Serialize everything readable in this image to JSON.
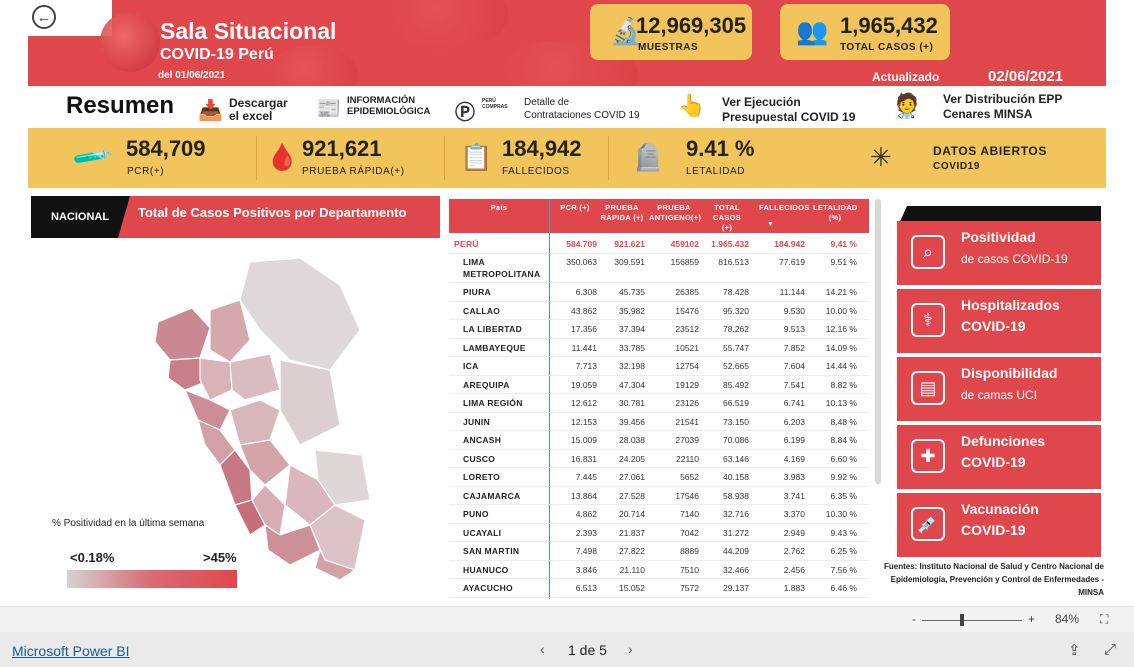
{
  "header": {
    "title": "Sala Situacional",
    "subtitle": "COVID-19 Perú",
    "date_label": "del 01/06/2021",
    "updated_label": "Actualizado",
    "updated_value": "02/06/2021",
    "muestras": {
      "value": "12,969,305",
      "label": "MUESTRAS",
      "icon": "microscope-icon"
    },
    "total_casos": {
      "value": "1,965,432",
      "label": "TOTAL CASOS (+)",
      "icon": "people-group-icon"
    }
  },
  "menu": {
    "resumen": "Resumen",
    "descargar": "Descargar el excel",
    "descargar_line1": "Descargar",
    "descargar_line2": "el excel",
    "info_epi_line1": "INFORMACIÓN",
    "info_epi_line2": "EPIDEMIOLÓGICA",
    "peru_compras": "PERÚ COMPRAS",
    "detalle_line1": "Detalle de",
    "detalle_line2": "Contrataciones COVID 19",
    "ejecucion_line1": "Ver Ejecución",
    "ejecucion_line2": "Presupuestal COVID 19",
    "epp_line1": "Ver Distribución EPP",
    "epp_line2": "Cenares MINSA"
  },
  "kpis": {
    "pcr": {
      "value": "584,709",
      "label": "PCR(+)"
    },
    "prueba_rapida": {
      "value": "921,621",
      "label": "PRUEBA RÁPIDA(+)"
    },
    "fallecidos": {
      "value": "184,942",
      "label": "FALLECIDOS"
    },
    "letalidad": {
      "value": "9.41 %",
      "label": "LETALIDAD"
    },
    "datos_abiertos": {
      "label1": "DATOS ABIERTOS",
      "label2": "COVID19"
    }
  },
  "map": {
    "tab": "NACIONAL",
    "title": "Total de Casos Positivos por Departamento",
    "legend_title": "% Positividad en la última semana",
    "legend_min": "<0.18%",
    "legend_max": ">45%"
  },
  "table": {
    "headers": [
      "País",
      "PCR (+)",
      "PRUEBA RÁPIDA (+)",
      "PRUEBA ANTIGENO(+)",
      "TOTAL CASOS (+)",
      "FALLECIDOS",
      "LETALIDAD (%)"
    ],
    "peru": [
      "PERÚ",
      "584.709",
      "921.621",
      "459102",
      "1.965.432",
      "184.942",
      "9,41 %"
    ],
    "rows": [
      [
        "LIMA METROPOLITANA",
        "350.063",
        "309.591",
        "156859",
        "816.513",
        "77.619",
        "9.51 %"
      ],
      [
        "PIURA",
        "6.308",
        "45.735",
        "26385",
        "78.428",
        "11.144",
        "14.21 %"
      ],
      [
        "CALLAO",
        "43.862",
        "35.982",
        "15476",
        "95.320",
        "9.530",
        "10.00 %"
      ],
      [
        "LA LIBERTAD",
        "17.356",
        "37.394",
        "23512",
        "78.262",
        "9.513",
        "12.16 %"
      ],
      [
        "LAMBAYEQUE",
        "11.441",
        "33.785",
        "10521",
        "55.747",
        "7.852",
        "14.09 %"
      ],
      [
        "ICA",
        "7.713",
        "32.198",
        "12754",
        "52.665",
        "7.604",
        "14.44 %"
      ],
      [
        "AREQUIPA",
        "19.059",
        "47.304",
        "19129",
        "85.492",
        "7.541",
        "8.82 %"
      ],
      [
        "LIMA REGIÓN",
        "12.612",
        "30.781",
        "23126",
        "66.519",
        "6.741",
        "10.13 %"
      ],
      [
        "JUNIN",
        "12.153",
        "39.456",
        "21541",
        "73.150",
        "6.203",
        "8.48 %"
      ],
      [
        "ANCASH",
        "15.009",
        "28.038",
        "27039",
        "70.086",
        "6.199",
        "8.84 %"
      ],
      [
        "CUSCO",
        "16.831",
        "24.205",
        "22110",
        "63.146",
        "4.169",
        "6.60 %"
      ],
      [
        "LORETO",
        "7.445",
        "27.061",
        "5652",
        "40.158",
        "3.983",
        "9.92 %"
      ],
      [
        "CAJAMARCA",
        "13.864",
        "27.528",
        "17546",
        "58.938",
        "3.741",
        "6.35 %"
      ],
      [
        "PUNO",
        "4.862",
        "20.714",
        "7140",
        "32.716",
        "3.370",
        "10.30 %"
      ],
      [
        "UCAYALI",
        "2.393",
        "21.837",
        "7042",
        "31.272",
        "2.949",
        "9.43 %"
      ],
      [
        "SAN MARTIN",
        "7.498",
        "27.822",
        "8889",
        "44.209",
        "2.762",
        "6.25 %"
      ],
      [
        "HUANUCO",
        "3.846",
        "21.110",
        "7510",
        "32.466",
        "2.456",
        "7.56 %"
      ],
      [
        "AYACUCHO",
        "6.513",
        "15.052",
        "7572",
        "29.137",
        "1.883",
        "6.46 %"
      ]
    ]
  },
  "side": {
    "positividad": {
      "l1": "Positividad",
      "l2": "de casos COVID-19"
    },
    "hospitalizados": {
      "l1": "Hospitalizados",
      "l2": "COVID-19"
    },
    "disponibilidad": {
      "l1": "Disponibilidad",
      "l2": "de camas UCI"
    },
    "defunciones": {
      "l1": "Defunciones",
      "l2": "COVID-19"
    },
    "vacunacion": {
      "l1": "Vacunación",
      "l2": "COVID-19"
    },
    "source": "Fuentes: Instituto Nacional de Salud y Centro Nacional de Epidemiología, Prevención y Control de Enfermedades -MINSA"
  },
  "footer": {
    "brand": "Microsoft Power BI",
    "page": "1 de 5",
    "zoom": "84%",
    "zoom_minus": "-",
    "zoom_plus": "+"
  }
}
